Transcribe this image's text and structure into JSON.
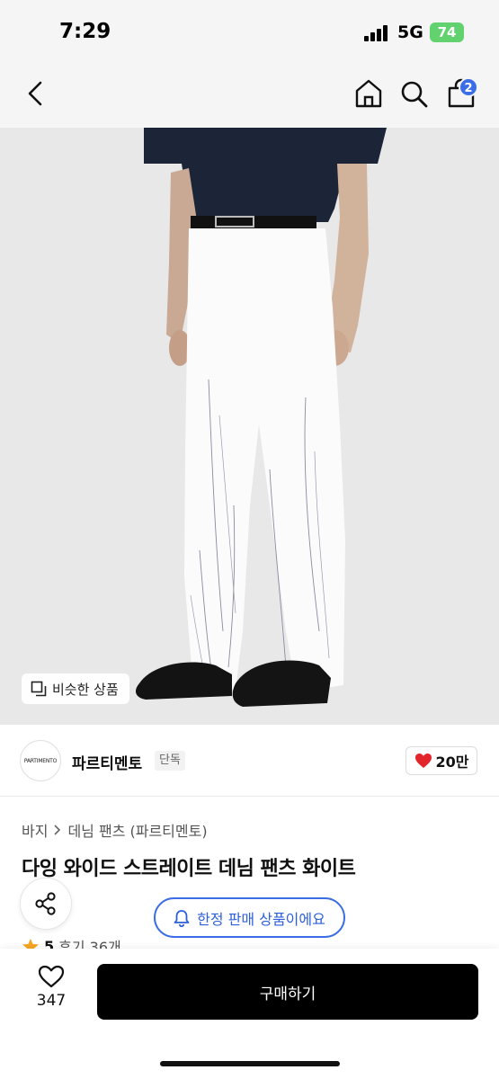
{
  "status_bar": {
    "time": "7:29",
    "network": "5G",
    "battery": "74"
  },
  "nav": {
    "cart_count": "2"
  },
  "image": {
    "similar_label": "비슷한 상품"
  },
  "brand": {
    "logo_text": "PARTIMENTO",
    "name": "파르티멘토",
    "exclusive_label": "단독",
    "likes": "20만"
  },
  "breadcrumb": {
    "category": "바지",
    "subcategory": "데님 팬츠 (파르티멘토)"
  },
  "product": {
    "title": "다잉 와이드 스트레이트 데님 팬츠 화이트",
    "limited_label": "한정 판매 상품이에요"
  },
  "rating": {
    "score": "5",
    "reviews": "후기 36개"
  },
  "bottom": {
    "wish_count": "347",
    "buy_label": "구매하기"
  },
  "colors": {
    "accent": "#3b6de6",
    "heart": "#e3262b",
    "buy_button": "#000000",
    "battery": "#62d26f"
  },
  "icons": [
    "chevron-left-icon",
    "home-icon",
    "search-icon",
    "shopping-bag-icon",
    "similar-icon",
    "heart-icon",
    "share-icon",
    "bell-icon",
    "star-icon",
    "heart-outline-icon"
  ]
}
